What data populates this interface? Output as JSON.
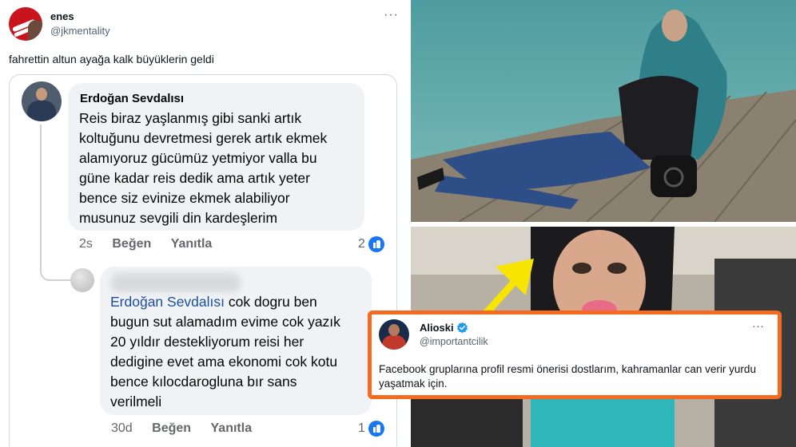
{
  "tweet": {
    "name": "enes",
    "handle": "@jkmentality",
    "more": "···",
    "text": "fahrettin altun ayağa kalk büyüklerin geldi"
  },
  "comment1": {
    "author": "Erdoğan Sevdalısı",
    "lines": [
      "Reis biraz yaşlanmış gibi sanki artık",
      "koltuğunu devretmesi gerek artık ekmek",
      "alamıyoruz gücümüz yetmiyor valla bu",
      "güne kadar reis dedik ama artık yeter",
      "bence siz evinize ekmek alabiliyor",
      "musunuz sevgili din kardeşlerim"
    ],
    "time": "2s",
    "like_label": "Beğen",
    "reply_label": "Yanıtla",
    "reaction_count": "2"
  },
  "comment2": {
    "mention": "Erdoğan Sevdalısı",
    "first_line_rest": " cok dogru ben",
    "lines": [
      "bugun sut alamadım evime cok yazık",
      "20 yıldır destekliyorum reisi her",
      "dedigine evet ama ekonomi cok kotu",
      "bence kılocdarogluna bır sans",
      "verilmeli"
    ],
    "time": "30d",
    "like_label": "Beğen",
    "reply_label": "Yanıtla",
    "reaction_count": "1"
  },
  "quote_tweet": {
    "name": "Alioski",
    "handle": "@importantcilik",
    "more": "···",
    "text": "Facebook gruplarına profil resmi önerisi dostlarım, kahramanlar can verir yurdu yaşatmak için."
  },
  "colors": {
    "highlight_border": "#f46a1f",
    "arrow": "#f7e400",
    "fb_like": "#1877f2",
    "mention": "#1b4f9c"
  }
}
